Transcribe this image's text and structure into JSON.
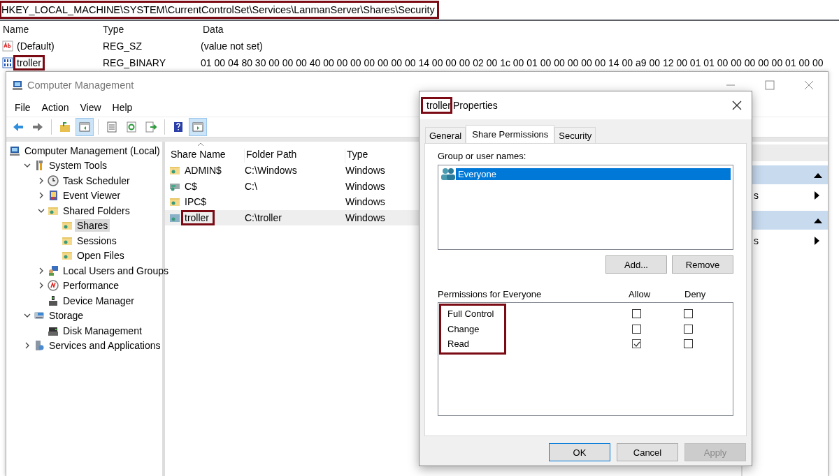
{
  "registry": {
    "path": {
      "text": "HKEY_LOCAL_MACHINE\\SYSTEM\\CurrentControlSet\\Services\\LanmanServer\\Shares\\Security",
      "annotated": true
    },
    "columns": [
      "Name",
      "Type",
      "Data"
    ],
    "rows": [
      {
        "kind": "string",
        "name": "(Default)",
        "annotated": false,
        "type": "REG_SZ",
        "data": "(value not set)"
      },
      {
        "kind": "binary",
        "name": "troller",
        "annotated": true,
        "type": "REG_BINARY",
        "data": "01 00 04 80 30 00 00 00 40 00 00 00 00 00 00 00 14 00 00 00 02 00 1c 00 01 00 00 00 00 00 14 00 a9 00 12 00 01 01 00 00 00 00 00 01 00 00"
      }
    ]
  },
  "window": {
    "title": "Computer Management",
    "menu": [
      "File",
      "Action",
      "View",
      "Help"
    ],
    "toolbar": [
      {
        "kind": "back",
        "pressed": false
      },
      {
        "kind": "forward",
        "pressed": false
      },
      {
        "kind": "sep"
      },
      {
        "kind": "folder-up",
        "pressed": false
      },
      {
        "kind": "pane",
        "pressed": true
      },
      {
        "kind": "sep"
      },
      {
        "kind": "list",
        "pressed": false
      },
      {
        "kind": "refresh",
        "pressed": false
      },
      {
        "kind": "export",
        "pressed": false
      },
      {
        "kind": "sep"
      },
      {
        "kind": "help",
        "pressed": false
      },
      {
        "kind": "action-pane",
        "pressed": true
      }
    ],
    "tree": [
      {
        "kind": "computer",
        "label": "Computer Management (Local)",
        "selected": false,
        "children": [
          {
            "kind": "tools",
            "label": "System Tools",
            "selected": false,
            "expanded": true,
            "children": [
              {
                "kind": "clock",
                "label": "Task Scheduler",
                "selected": false,
                "expanded": false
              },
              {
                "kind": "log",
                "label": "Event Viewer",
                "selected": false,
                "expanded": false
              },
              {
                "kind": "share",
                "label": "Shared Folders",
                "selected": false,
                "expanded": true,
                "children": [
                  {
                    "kind": "share",
                    "label": "Shares",
                    "selected": true
                  },
                  {
                    "kind": "share",
                    "label": "Sessions",
                    "selected": false
                  },
                  {
                    "kind": "share",
                    "label": "Open Files",
                    "selected": false
                  }
                ]
              },
              {
                "kind": "users",
                "label": "Local Users and Groups",
                "selected": false,
                "expanded": false
              },
              {
                "kind": "gauge",
                "label": "Performance",
                "selected": false,
                "expanded": false
              },
              {
                "kind": "device",
                "label": "Device Manager",
                "selected": false
              }
            ]
          },
          {
            "kind": "storage",
            "label": "Storage",
            "selected": false,
            "expanded": true,
            "children": [
              {
                "kind": "disk",
                "label": "Disk Management",
                "selected": false
              }
            ]
          },
          {
            "kind": "services",
            "label": "Services and Applications",
            "selected": false,
            "expanded": false
          }
        ]
      }
    ],
    "shares": {
      "columns": [
        "Share Name",
        "Folder Path",
        "Type"
      ],
      "rows": [
        {
          "kind": "admin",
          "name": "ADMIN$",
          "annotated": false,
          "path": "C:\\Windows",
          "type": "Windows",
          "selected": false
        },
        {
          "kind": "drive",
          "name": "C$",
          "annotated": false,
          "path": "C:\\",
          "type": "Windows",
          "selected": false
        },
        {
          "kind": "admin",
          "name": "IPC$",
          "annotated": false,
          "type": "Windows",
          "selected": false
        },
        {
          "kind": "network",
          "name": "troller",
          "annotated": true,
          "path": "C:\\troller",
          "type": "Windows",
          "selected": true
        }
      ]
    },
    "actions": [
      {
        "items": [
          "s"
        ]
      },
      {
        "items": [
          "s"
        ]
      }
    ]
  },
  "dialog": {
    "title": {
      "name": "troller",
      "annotated": true,
      "suffix": "Properties"
    },
    "tabs": [
      {
        "label": "General",
        "selected": false
      },
      {
        "label": "Share Permissions",
        "selected": true
      },
      {
        "label": "Security",
        "selected": false
      }
    ],
    "group_label": "Group or user names:",
    "users": [
      {
        "name": "Everyone",
        "selected": true
      }
    ],
    "user_buttons": [
      "Add...",
      "Remove"
    ],
    "permissions": {
      "label": "Permissions for Everyone",
      "allow_label": "Allow",
      "deny_label": "Deny",
      "annotated": true,
      "items": [
        {
          "name": "Full Control",
          "allow": false,
          "deny": false
        },
        {
          "name": "Change",
          "allow": false,
          "deny": false
        },
        {
          "name": "Read",
          "allow": true,
          "deny": false
        }
      ]
    },
    "buttons": [
      {
        "label": "OK",
        "default": true,
        "disabled": false
      },
      {
        "label": "Cancel",
        "default": false,
        "disabled": false
      },
      {
        "label": "Apply",
        "default": false,
        "disabled": true
      }
    ]
  }
}
